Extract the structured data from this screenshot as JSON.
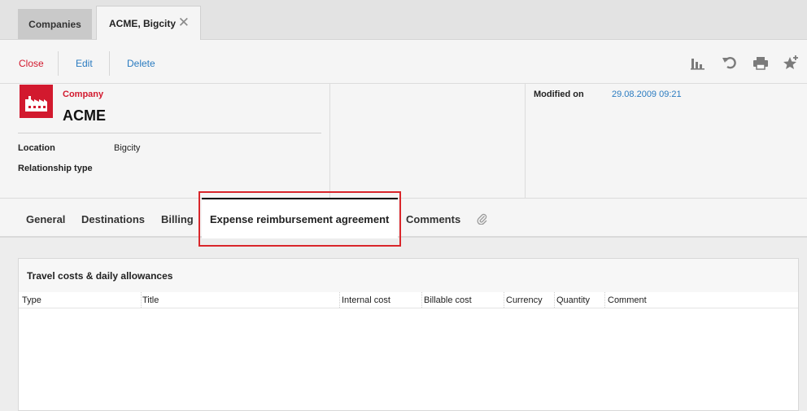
{
  "top_tabs": [
    {
      "label": "Companies"
    },
    {
      "label": "ACME, Bigcity"
    }
  ],
  "toolbar": {
    "close_label": "Close",
    "edit_label": "Edit",
    "delete_label": "Delete",
    "icons": [
      "chart-icon",
      "undo-icon",
      "print-icon",
      "star-add-icon"
    ]
  },
  "header": {
    "type_label": "Company",
    "name": "ACME",
    "fields": [
      {
        "label": "Location",
        "value": "Bigcity"
      },
      {
        "label": "Relationship type",
        "value": ""
      }
    ],
    "modified_label": "Modified on",
    "modified_value": "29.08.2009 09:21"
  },
  "section_tabs": [
    {
      "label": "General"
    },
    {
      "label": "Destinations"
    },
    {
      "label": "Billing"
    },
    {
      "label": "Expense reimbursement agreement"
    },
    {
      "label": "Comments"
    }
  ],
  "panel": {
    "title": "Travel costs & daily allowances",
    "columns": [
      "Type",
      "Title",
      "Internal cost",
      "Billable cost",
      "Currency",
      "Quantity",
      "Comment"
    ]
  },
  "colors": {
    "accent_red": "#d2192e",
    "link_blue": "#2a7bc0",
    "highlight_red": "#d9262b"
  }
}
